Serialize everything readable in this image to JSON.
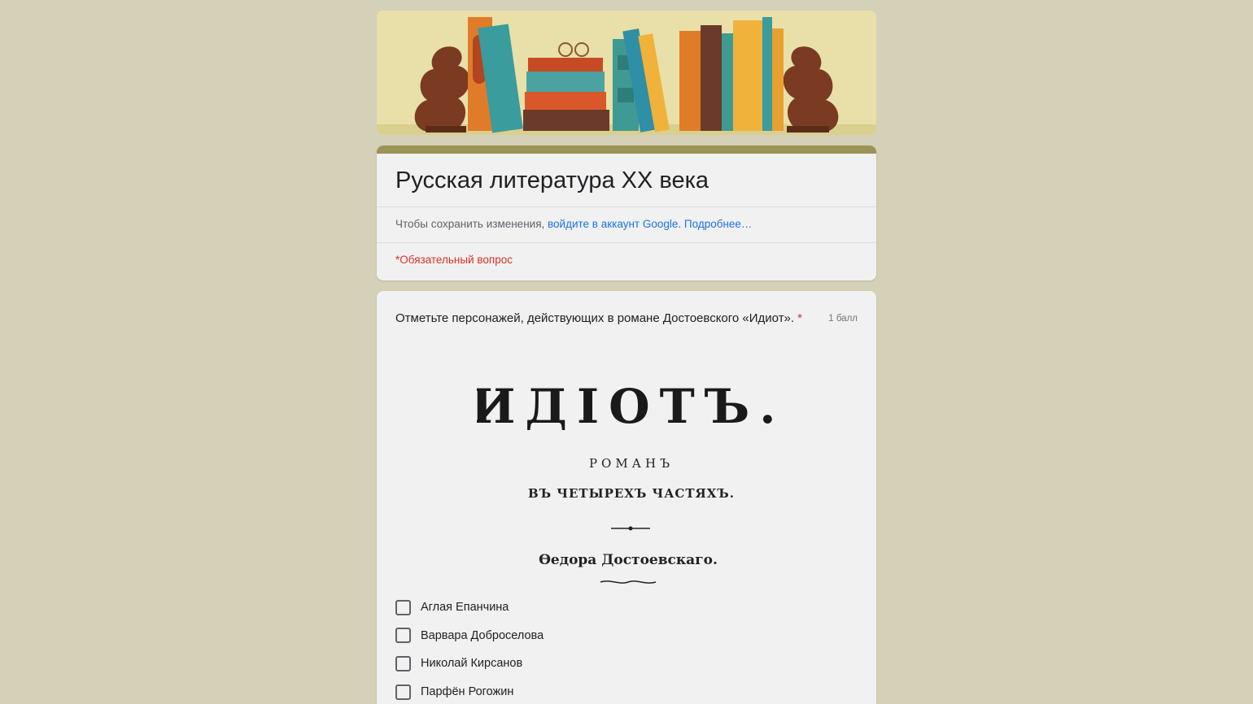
{
  "form": {
    "title": "Русская литература XX века",
    "signin_prefix": "Чтобы сохранить изменения,",
    "signin_link": "войдите в аккаунт Google.",
    "more_link": "Подробнее…",
    "required_note": "*Обязательный вопрос"
  },
  "question": {
    "text": "Отметьте персонажей, действующих в романе Достоевского «Идиот».",
    "required_mark": "*",
    "points": "1 балл",
    "image": {
      "title": "ИДІОТЪ.",
      "subtitle": "РОМАНЪ",
      "parts": "ВЪ ЧЕТЫРЕХЪ ЧАСТЯХЪ.",
      "author": "Ѳедора Достоевскаго."
    },
    "options": [
      {
        "label": "Аглая Епанчина",
        "checked": false
      },
      {
        "label": "Варвара Доброселова",
        "checked": false
      },
      {
        "label": "Николай Кирсанов",
        "checked": false
      },
      {
        "label": "Парфён Рогожин",
        "checked": false
      }
    ]
  },
  "colors": {
    "background": "#d4d1b8",
    "card": "#f1f1f1",
    "accent": "#9b9357",
    "link": "#1a73e8",
    "required": "#d93025"
  }
}
